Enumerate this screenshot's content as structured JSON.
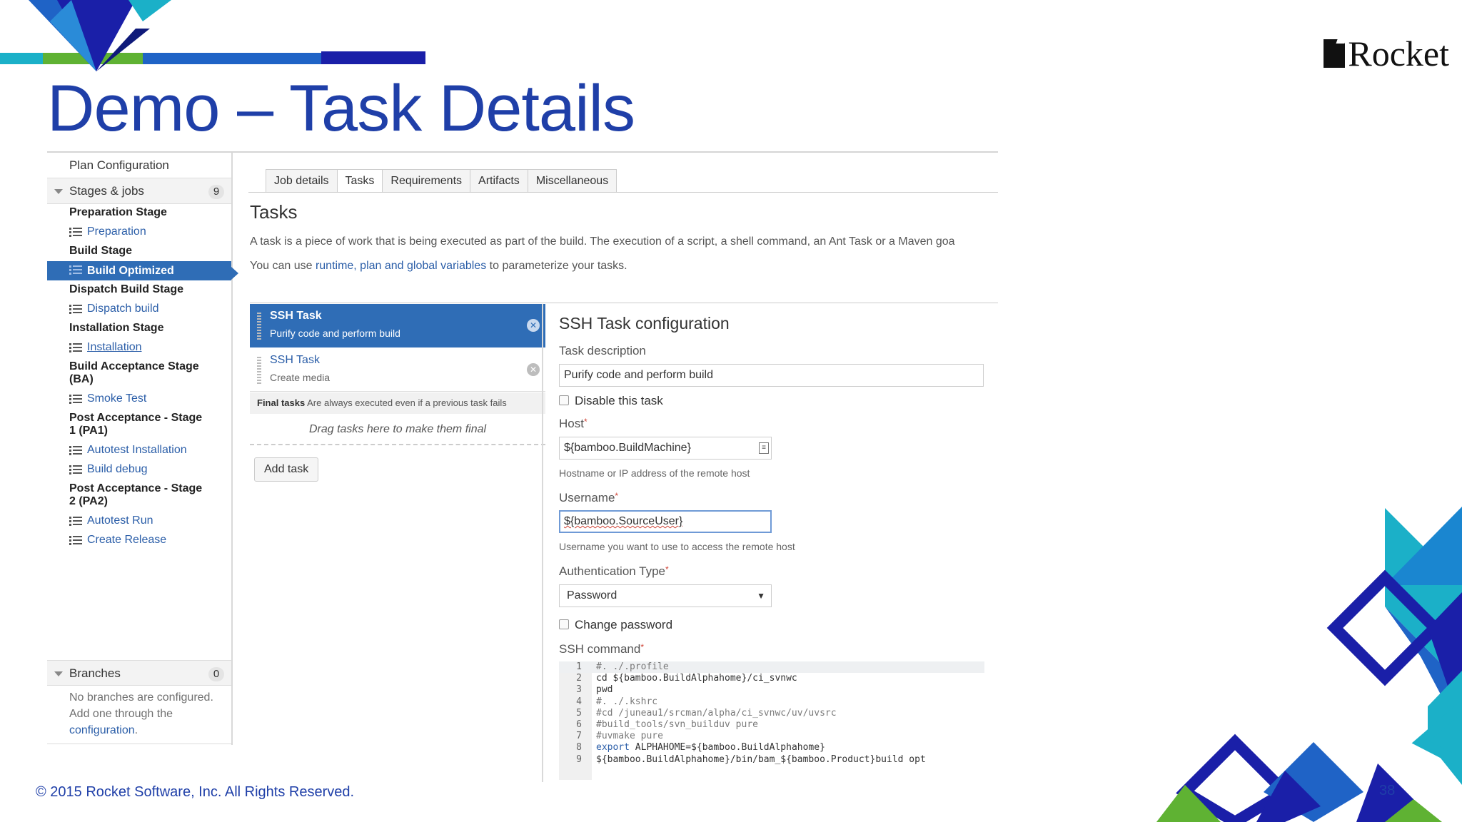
{
  "slide": {
    "title": "Demo – Task Details",
    "footer": "© 2015 Rocket Software, Inc. All Rights Reserved.",
    "page_number": "38",
    "logo_text": "Rocket",
    "brand_color": "#1f3fa8"
  },
  "sidebar": {
    "plan_configuration": "Plan Configuration",
    "stages_label": "Stages & jobs",
    "stages_count": "9",
    "items": [
      {
        "type": "stage",
        "label": "Preparation Stage"
      },
      {
        "type": "job",
        "label": "Preparation"
      },
      {
        "type": "stage",
        "label": "Build Stage"
      },
      {
        "type": "job-active",
        "label": "Build Optimized"
      },
      {
        "type": "stage",
        "label": "Dispatch Build Stage"
      },
      {
        "type": "job",
        "label": "Dispatch build"
      },
      {
        "type": "stage",
        "label": "Installation Stage"
      },
      {
        "type": "job",
        "label": "Installation"
      },
      {
        "type": "stage",
        "label": "Build Acceptance Stage"
      },
      {
        "type": "stage-cont",
        "label": "(BA)"
      },
      {
        "type": "job",
        "label": "Smoke Test"
      },
      {
        "type": "stage",
        "label": "Post Acceptance - Stage"
      },
      {
        "type": "stage-cont",
        "label": "1 (PA1)"
      },
      {
        "type": "job",
        "label": "Autotest Installation"
      },
      {
        "type": "job",
        "label": "Build debug"
      },
      {
        "type": "stage",
        "label": "Post Acceptance - Stage"
      },
      {
        "type": "stage-cont",
        "label": "2 (PA2)"
      },
      {
        "type": "job",
        "label": "Autotest Run"
      },
      {
        "type": "job",
        "label": "Create Release"
      }
    ],
    "branches_label": "Branches",
    "branches_count": "0",
    "branches_note_1": "No branches are configured.",
    "branches_note_2": "Add one through the",
    "branches_note_link": "configuration",
    "branches_note_end": "."
  },
  "tabs": [
    "Job details",
    "Tasks",
    "Requirements",
    "Artifacts",
    "Miscellaneous"
  ],
  "active_tab": "Tasks",
  "tasks_section": {
    "heading": "Tasks",
    "description": "A task is a piece of work that is being executed as part of the build. The execution of a script, a shell command, an Ant Task or a Maven goa",
    "vars_prefix": "You can use ",
    "vars_link": "runtime, plan and global variables",
    "vars_suffix": " to parameterize your tasks."
  },
  "task_list": {
    "tasks": [
      {
        "name": "SSH Task",
        "description": "Purify code and perform build",
        "selected": true
      },
      {
        "name": "SSH Task",
        "description": "Create media",
        "selected": false
      }
    ],
    "final_tasks_label": "Final tasks",
    "final_tasks_note": "Are always executed even if a previous task fails",
    "drop_zone": "Drag tasks here to make them final",
    "add_task": "Add task"
  },
  "config": {
    "title": "SSH Task configuration",
    "task_description_label": "Task description",
    "task_description_value": "Purify code and perform build",
    "disable_task_label": "Disable this task",
    "host_label": "Host",
    "host_value": "${bamboo.BuildMachine}",
    "host_help": "Hostname or IP address of the remote host",
    "username_label": "Username",
    "username_value": "${bamboo.SourceUser}",
    "username_help": "Username you want to use to access the remote host",
    "auth_type_label": "Authentication Type",
    "auth_type_value": "Password",
    "change_password_label": "Change password",
    "ssh_command_label": "SSH command",
    "required_mark": "*"
  },
  "ssh_command": {
    "lines": [
      {
        "n": "1",
        "text": "#. ./.profile"
      },
      {
        "n": "2",
        "text": "cd ${bamboo.BuildAlphahome}/ci_svnwc"
      },
      {
        "n": "3",
        "text": "pwd"
      },
      {
        "n": "4",
        "text": "#. ./.kshrc"
      },
      {
        "n": "5",
        "text": "#cd /juneau1/srcman/alpha/ci_svnwc/uv/uvsrc"
      },
      {
        "n": "6",
        "text": "#build_tools/svn_builduv pure"
      },
      {
        "n": "7",
        "text": "#uvmake pure"
      },
      {
        "n": "8",
        "text": "export ALPHAHOME=${bamboo.BuildAlphahome}"
      },
      {
        "n": "9",
        "text": "${bamboo.BuildAlphahome}/bin/bam_${bamboo.Product}build opt"
      }
    ]
  }
}
